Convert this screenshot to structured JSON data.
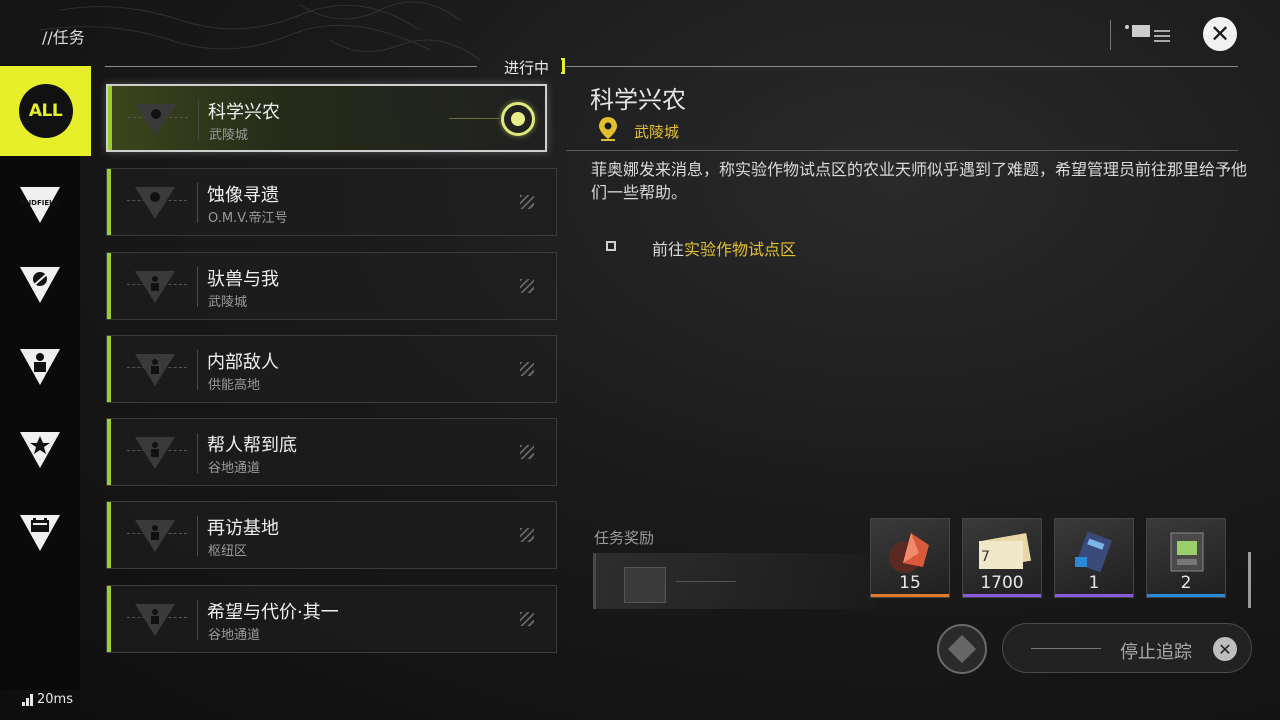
{
  "header": {
    "breadcrumb": "//任务",
    "status_label": "进行中",
    "close_icon": "close-icon"
  },
  "sidebar": {
    "items": [
      {
        "label": "ALL",
        "icon": "all-icon",
        "active": true
      },
      {
        "label": "ENDFIELD",
        "icon": "endfield-icon"
      },
      {
        "label": "",
        "icon": "leaf-icon"
      },
      {
        "label": "",
        "icon": "person-icon"
      },
      {
        "label": "",
        "icon": "star-icon"
      },
      {
        "label": "",
        "icon": "battery-icon"
      }
    ]
  },
  "quests": [
    {
      "title": "科学兴农",
      "location": "武陵城",
      "active": true
    },
    {
      "title": "蚀像寻遗",
      "location": "O.M.V.帝江号"
    },
    {
      "title": "驮兽与我",
      "location": "武陵城"
    },
    {
      "title": "内部敌人",
      "location": "供能高地"
    },
    {
      "title": "帮人帮到底",
      "location": "谷地通道"
    },
    {
      "title": "再访基地",
      "location": "枢纽区"
    },
    {
      "title": "希望与代价·其一",
      "location": "谷地通道"
    }
  ],
  "detail": {
    "title": "科学兴农",
    "location": "武陵城",
    "description": "菲奥娜发来消息，称实验作物试点区的农业天师似乎遇到了难题，希望管理员前往那里给予他们一些帮助。",
    "objective_prefix": "前往",
    "objective_target": "实验作物试点区"
  },
  "rewards": {
    "label": "任务奖励",
    "items": [
      {
        "count": "15",
        "color": "#e07a2a"
      },
      {
        "count": "1700",
        "color": "#8a5ad8"
      },
      {
        "count": "1",
        "color": "#8a5ad8"
      },
      {
        "count": "2",
        "color": "#2a8ad8"
      }
    ]
  },
  "controls": {
    "stop_tracking": "停止追踪"
  },
  "status": {
    "ping": "20ms"
  },
  "colors": {
    "accent": "#e6ef2a",
    "location": "#e3c12e",
    "list_accent": "#9ccf2a"
  }
}
